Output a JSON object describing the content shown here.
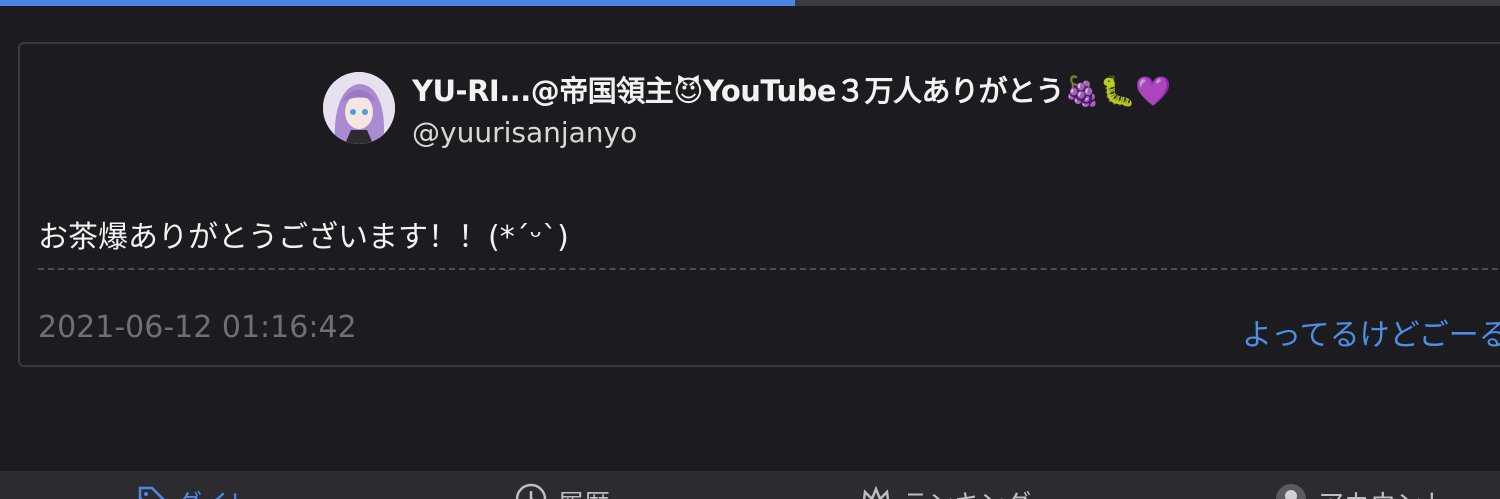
{
  "progress": {
    "fraction": 0.53,
    "color": "#4c86e8"
  },
  "tweet": {
    "display_name": "YU-RI...@帝国領主😈YouTube３万人ありがとう🍇🐛💜",
    "handle": "@yuurisanjanyo",
    "text": "お茶爆ありがとうございます！！(*´ᵕ`)",
    "timestamp": "2021-06-12 01:16:42",
    "author_link": "よってるけどごーる"
  },
  "bottom_nav": {
    "items": [
      {
        "label": "ダイレ",
        "icon": "tag-icon",
        "active": true
      },
      {
        "label": "履歴",
        "icon": "clock-icon",
        "active": false
      },
      {
        "label": "ランキング",
        "icon": "crown-icon",
        "active": false
      },
      {
        "label": "アカウント",
        "icon": "avatar-icon",
        "active": false
      }
    ]
  },
  "colors": {
    "background": "#1c1c20",
    "accent": "#4c86e8",
    "link": "#4e8fe6",
    "muted_text": "#6f6f74"
  }
}
